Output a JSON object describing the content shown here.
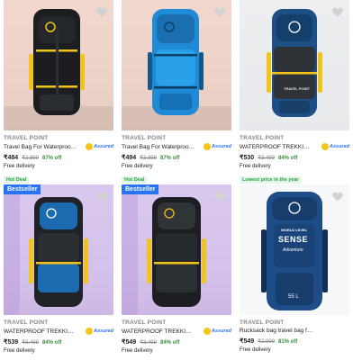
{
  "products": [
    {
      "brand": "TRAVEL POINT",
      "title": "Travel Bag For Waterproof Trekking Bag",
      "assured": "Assured",
      "price": "₹484",
      "mrp": "₹2,899",
      "off": "87% off",
      "delivery": "Free delivery",
      "tag": "Hot Deal",
      "badge": ""
    },
    {
      "brand": "TRAVEL POINT",
      "title": "Travel Bag For Waterproof Trekking Bag",
      "assured": "Assured",
      "price": "₹494",
      "mrp": "₹3,899",
      "off": "87% off",
      "delivery": "Free delivery",
      "tag": "Hot Deal",
      "badge": ""
    },
    {
      "brand": "TRAVEL POINT",
      "title": "WATERPROOF TREKKING BAG HI...",
      "assured": "Assured",
      "price": "₹530",
      "mrp": "₹3,499",
      "off": "84% off",
      "delivery": "Free delivery",
      "tag": "Lowest price in the year",
      "badge": ""
    },
    {
      "brand": "TRAVEL POINT",
      "title": "WATERPROOF TREKKING BAG HI...",
      "assured": "Assured",
      "price": "₹539",
      "mrp": "₹3,499",
      "off": "84% off",
      "delivery": "Free delivery",
      "tag": "",
      "badge": "Bestseller"
    },
    {
      "brand": "TRAVEL POINT",
      "title": "WATERPROOF TREKKING BAG HI...",
      "assured": "Assured",
      "price": "₹549",
      "mrp": "₹3,499",
      "off": "84% off",
      "delivery": "Free delivery",
      "tag": "",
      "badge": "Bestseller"
    },
    {
      "brand": "TRAVEL POINT",
      "title": "Rucksack bag travel bag for men ...",
      "assured": "Assured",
      "price": "₹549",
      "mrp": "₹2,999",
      "off": "81% off",
      "delivery": "Free delivery",
      "tag": "",
      "badge": ""
    }
  ],
  "bag_labels": {
    "p3": "TRAVEL POINT",
    "p6_patch_top": "WORLD LEVEL",
    "p6_patch_main": "SENSE",
    "p6_patch_sub": "Adventure",
    "p6_capacity": "55 L"
  },
  "icons": {
    "wishlist": "heart-icon",
    "assured": "assured-badge-icon"
  },
  "colors": {
    "accent": "#2874f0",
    "discount": "#388e3c",
    "tag": "#26a541"
  }
}
